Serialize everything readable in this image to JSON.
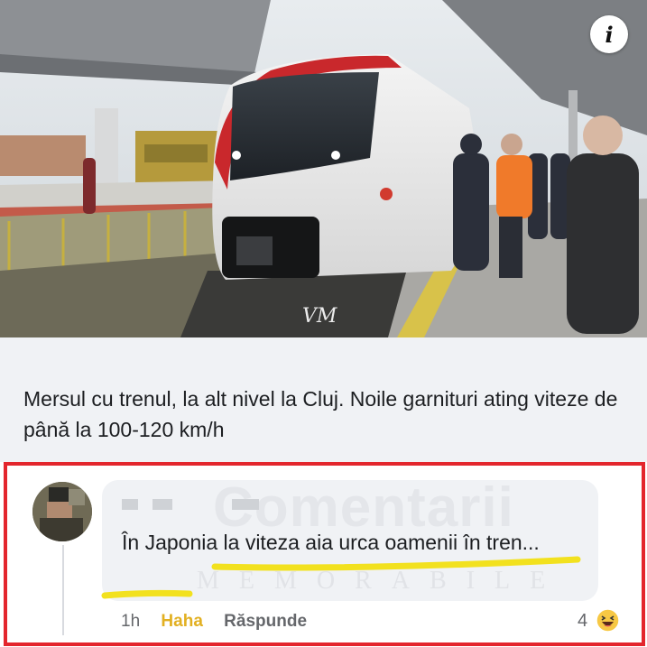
{
  "post": {
    "headline": "Mersul cu trenul, la alt nivel la Cluj. Noile garnituri ating viteze de până la 100-120 km/h",
    "photo_watermark": "VM",
    "info_icon_glyph": "i"
  },
  "comment": {
    "text": "În Japonia la viteza aia urca oamenii în tren...",
    "background_watermark": "Comentarii",
    "background_watermark_sub": "MEMORABILE",
    "time": "1h",
    "reaction_action": "Haha",
    "reply_action": "Răspunde",
    "reaction_count": "4",
    "reaction_icon": "haha-emoji-icon"
  },
  "colors": {
    "frame_red": "#e3262d",
    "highlighter_yellow": "#f2e11e",
    "haha_gold": "#e2b022",
    "text_dark": "#1c1e21",
    "text_muted": "#65676b"
  }
}
